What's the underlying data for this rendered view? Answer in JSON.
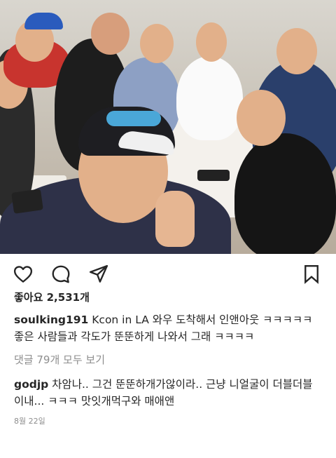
{
  "post": {
    "likes_label": "좋아요 2,531개",
    "caption_user": "soulking191",
    "caption_text": " Kcon in LA 와우 도착해서 인앤아웃 ㅋㅋㅋㅋㅋ 좋은 사람들과 각도가 뚠뚠하게 나와서 그래 ㅋㅋㅋㅋ",
    "view_comments_label": "댓글 79개 모두 보기",
    "comment_user": "godjp",
    "comment_text": " 차암나.. 그건 뚠뚠하개가않이라.. 근냥 니얼굴이 더블더블이내... ㅋㅋㅋ 맛잇개먹구와 매애앤",
    "date": "8월 22일"
  },
  "icons": {
    "like": "heart-outline-icon",
    "comment": "comment-bubble-icon",
    "share": "paper-plane-icon",
    "save": "bookmark-outline-icon"
  }
}
